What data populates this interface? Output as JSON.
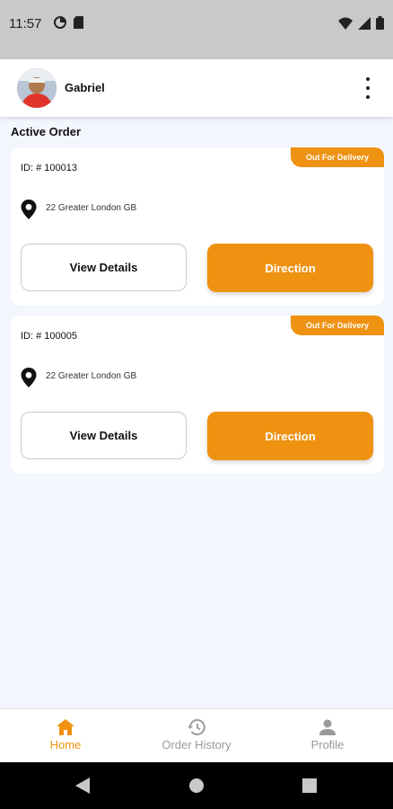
{
  "status_bar": {
    "time": "11:57"
  },
  "header": {
    "user_name": "Gabriel"
  },
  "section": {
    "title": "Active Order"
  },
  "orders": [
    {
      "id_label": "ID: # 100013",
      "status": "Out For Delivery",
      "address": "22 Greater London GB",
      "details_label": "View Details",
      "direction_label": "Direction"
    },
    {
      "id_label": "ID: # 100005",
      "status": "Out For Delivery",
      "address": "22 Greater London GB",
      "details_label": "View Details",
      "direction_label": "Direction"
    }
  ],
  "bottom_nav": {
    "items": [
      {
        "label": "Home",
        "icon": "home-icon",
        "active": true
      },
      {
        "label": "Order History",
        "icon": "history-icon",
        "active": false
      },
      {
        "label": "Profile",
        "icon": "person-icon",
        "active": false
      }
    ]
  },
  "colors": {
    "accent": "#ef9211",
    "inactive": "#9a9a9a",
    "background": "#f3f6fc"
  }
}
